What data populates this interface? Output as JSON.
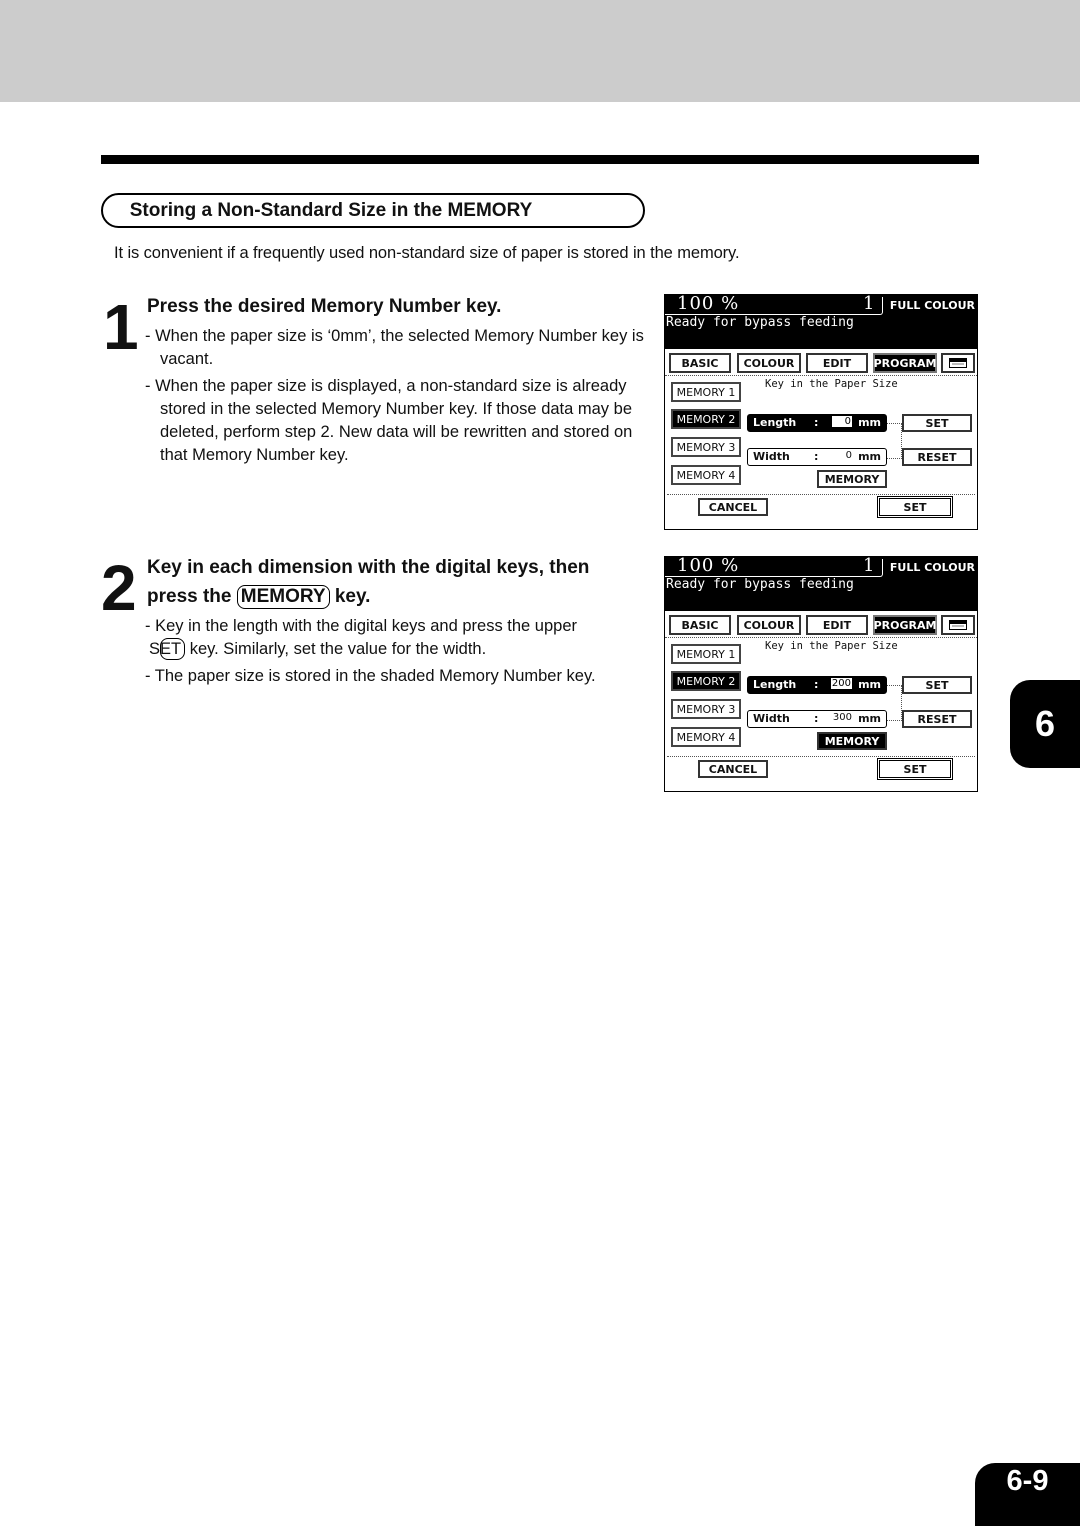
{
  "section": {
    "title": "Storing a Non-Standard Size in the MEMORY",
    "intro": "It is convenient if a frequently used non-standard size of paper is stored in the memory."
  },
  "steps": [
    {
      "number": "1",
      "title": "Press the desired Memory Number key.",
      "bullets": [
        "- When the paper size is ‘0mm’, the selected Memory Number key is vacant.",
        "- When the paper size is displayed, a non-standard size is already stored in the selected Memory Number key.  If those data may be deleted, perform step 2.  New data will be rewritten and stored on that Memory Number key."
      ]
    },
    {
      "number": "2",
      "title_part1": "Key in  each dimension  with the digital keys,  then",
      "title_part2_pre": "press the",
      "title_key": "MEMORY",
      "title_part2_post": "key.",
      "bullet1_pre": "- Key in the length with the digital keys and press the upper",
      "bullet1_key": "SET",
      "bullet1_post": "key.  Similarly, set the value for the width.",
      "bullet2": "- The paper size is stored in the shaded Memory Number key."
    }
  ],
  "screens": [
    {
      "zoom": "100 %",
      "copies": "1",
      "mode": "FULL COLOUR",
      "message": "Ready for bypass feeding",
      "tabs": [
        "BASIC",
        "COLOUR",
        "EDIT",
        "PROGRAM"
      ],
      "active_tab": "PROGRAM",
      "panel_title": "Key in the Paper Size",
      "memory_keys": [
        "MEMORY 1",
        "MEMORY 2",
        "MEMORY 3",
        "MEMORY 4"
      ],
      "active_memory": "MEMORY 2",
      "length_label": "Length",
      "length_value": "0",
      "width_label": "Width",
      "width_value": "0",
      "unit": "mm",
      "colon": ":",
      "set_label": "SET",
      "reset_label": "RESET",
      "memory_label": "MEMORY",
      "cancel_label": "CANCEL",
      "set_bottom_label": "SET"
    },
    {
      "zoom": "100 %",
      "copies": "1",
      "mode": "FULL COLOUR",
      "message": "Ready for bypass feeding",
      "tabs": [
        "BASIC",
        "COLOUR",
        "EDIT",
        "PROGRAM"
      ],
      "active_tab": "PROGRAM",
      "panel_title": "Key in the Paper Size",
      "memory_keys": [
        "MEMORY 1",
        "MEMORY 2",
        "MEMORY 3",
        "MEMORY 4"
      ],
      "active_memory": "MEMORY 2",
      "length_label": "Length",
      "length_value": "200",
      "width_label": "Width",
      "width_value": "300",
      "unit": "mm",
      "colon": ":",
      "set_label": "SET",
      "reset_label": "RESET",
      "memory_label": "MEMORY",
      "memory_highlighted": true,
      "cancel_label": "CANCEL",
      "set_bottom_label": "SET"
    }
  ],
  "chapter_tab": "6",
  "page_number": "6-9"
}
